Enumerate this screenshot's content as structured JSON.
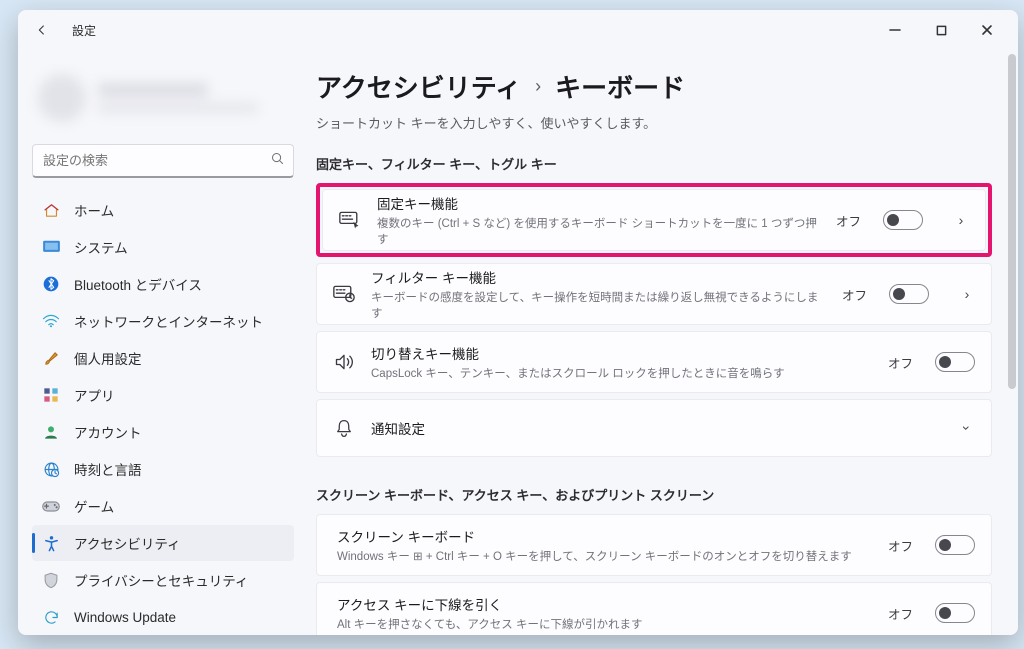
{
  "window": {
    "title": "設定"
  },
  "search": {
    "placeholder": "設定の検索"
  },
  "sidebar": {
    "items": [
      {
        "label": "ホーム"
      },
      {
        "label": "システム"
      },
      {
        "label": "Bluetooth とデバイス"
      },
      {
        "label": "ネットワークとインターネット"
      },
      {
        "label": "個人用設定"
      },
      {
        "label": "アプリ"
      },
      {
        "label": "アカウント"
      },
      {
        "label": "時刻と言語"
      },
      {
        "label": "ゲーム"
      },
      {
        "label": "アクセシビリティ"
      },
      {
        "label": "プライバシーとセキュリティ"
      },
      {
        "label": "Windows Update"
      }
    ]
  },
  "breadcrumb": {
    "parent": "アクセシビリティ",
    "current": "キーボード"
  },
  "subhead": "ショートカット キーを入力しやすく、使いやすくします。",
  "sections": {
    "a": "固定キー、フィルター キー、トグル キー",
    "b": "スクリーン キーボード、アクセス キー、およびプリント スクリーン"
  },
  "rows": {
    "sticky": {
      "title": "固定キー機能",
      "desc": "複数のキー (Ctrl + S など) を使用するキーボード ショートカットを一度に 1 つずつ押す",
      "state": "オフ"
    },
    "filter": {
      "title": "フィルター キー機能",
      "desc": "キーボードの感度を設定して、キー操作を短時間または繰り返し無視できるようにします",
      "state": "オフ"
    },
    "toggle": {
      "title": "切り替えキー機能",
      "desc": "CapsLock キー、テンキー、またはスクロール ロックを押したときに音を鳴らす",
      "state": "オフ"
    },
    "notify": {
      "title": "通知設定"
    },
    "osk": {
      "title": "スクリーン キーボード",
      "desc": "Windows キー ⊞ + Ctrl キー + O キーを押して、スクリーン キーボードのオンとオフを切り替えます",
      "state": "オフ"
    },
    "underline": {
      "title": "アクセス キーに下線を引く",
      "desc": "Alt キーを押さなくても、アクセス キーに下線が引かれます",
      "state": "オフ"
    }
  }
}
